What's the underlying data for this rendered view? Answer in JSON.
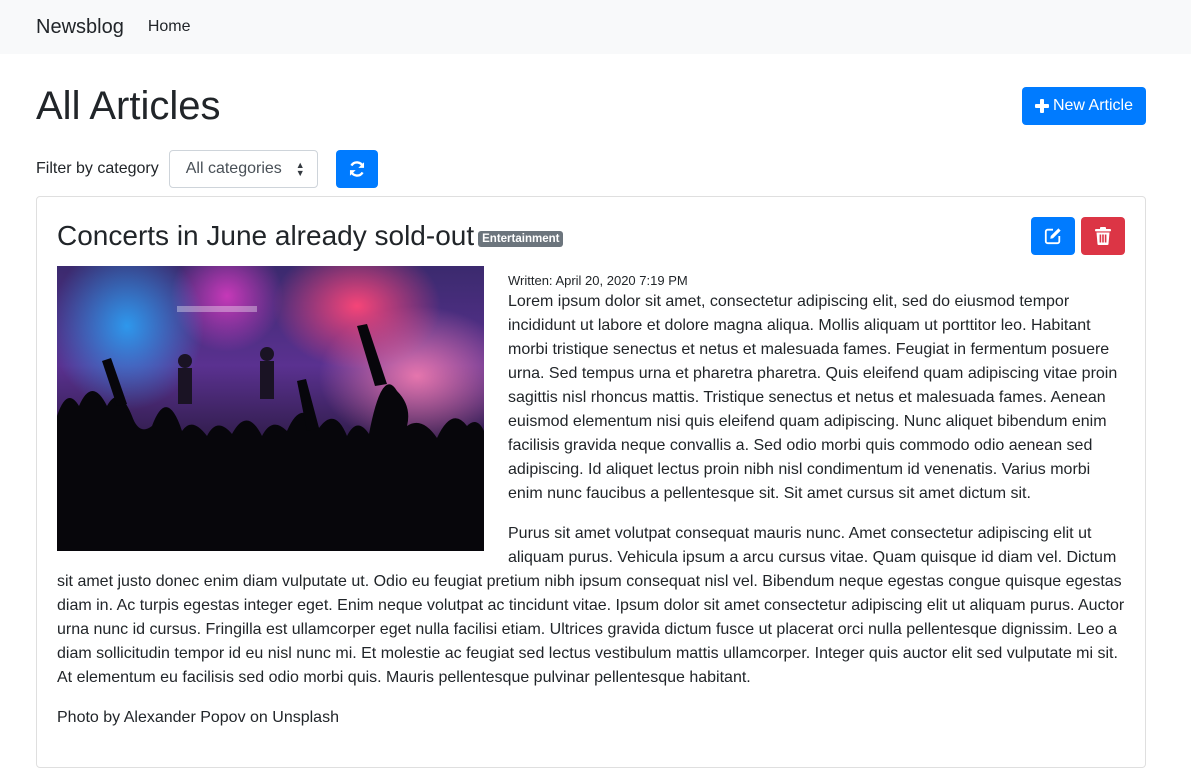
{
  "navbar": {
    "brand": "Newsblog",
    "home": "Home"
  },
  "page": {
    "title": "All Articles",
    "new_article_label": "New Article"
  },
  "filter": {
    "label": "Filter by category",
    "selected": "All categories"
  },
  "article": {
    "title": "Concerts in June already sold-out",
    "category": "Entertainment",
    "written": "Written: April 20, 2020 7:19 PM",
    "paragraphs": [
      "Lorem ipsum dolor sit amet, consectetur adipiscing elit, sed do eiusmod tempor incididunt ut labore et dolore magna aliqua. Mollis aliquam ut porttitor leo. Habitant morbi tristique senectus et netus et malesuada fames. Feugiat in fermentum posuere urna. Sed tempus urna et pharetra pharetra. Quis eleifend quam adipiscing vitae proin sagittis nisl rhoncus mattis. Tristique senectus et netus et malesuada fames. Aenean euismod elementum nisi quis eleifend quam adipiscing. Nunc aliquet bibendum enim facilisis gravida neque convallis a. Sed odio morbi quis commodo odio aenean sed adipiscing. Id aliquet lectus proin nibh nisl condimentum id venenatis. Varius morbi enim nunc faucibus a pellentesque sit. Sit amet cursus sit amet dictum sit.",
      "Purus sit amet volutpat consequat mauris nunc. Amet consectetur adipiscing elit ut aliquam purus. Vehicula ipsum a arcu cursus vitae. Quam quisque id diam vel. Dictum sit amet justo donec enim diam vulputate ut. Odio eu feugiat pretium nibh ipsum consequat nisl vel. Bibendum neque egestas congue quisque egestas diam in. Ac turpis egestas integer eget. Enim neque volutpat ac tincidunt vitae. Ipsum dolor sit amet consectetur adipiscing elit ut aliquam purus. Auctor urna nunc id cursus. Fringilla est ullamcorper eget nulla facilisi etiam. Ultrices gravida dictum fusce ut placerat orci nulla pellentesque dignissim. Leo a diam sollicitudin tempor id eu nisl nunc mi. Et molestie ac feugiat sed lectus vestibulum mattis ullamcorper. Integer quis auctor elit sed vulputate mi sit. At elementum eu facilisis sed odio morbi quis. Mauris pellentesque pulvinar pellentesque habitant."
    ],
    "credit": "Photo by Alexander Popov on Unsplash"
  },
  "colors": {
    "primary": "#007bff",
    "danger": "#dc3545",
    "badge": "#6c757d",
    "navbar_bg": "#f8f9fa"
  },
  "icons": {
    "new_article": "plus-icon",
    "refresh": "sync-icon",
    "edit": "edit-icon",
    "delete": "trash-icon"
  }
}
